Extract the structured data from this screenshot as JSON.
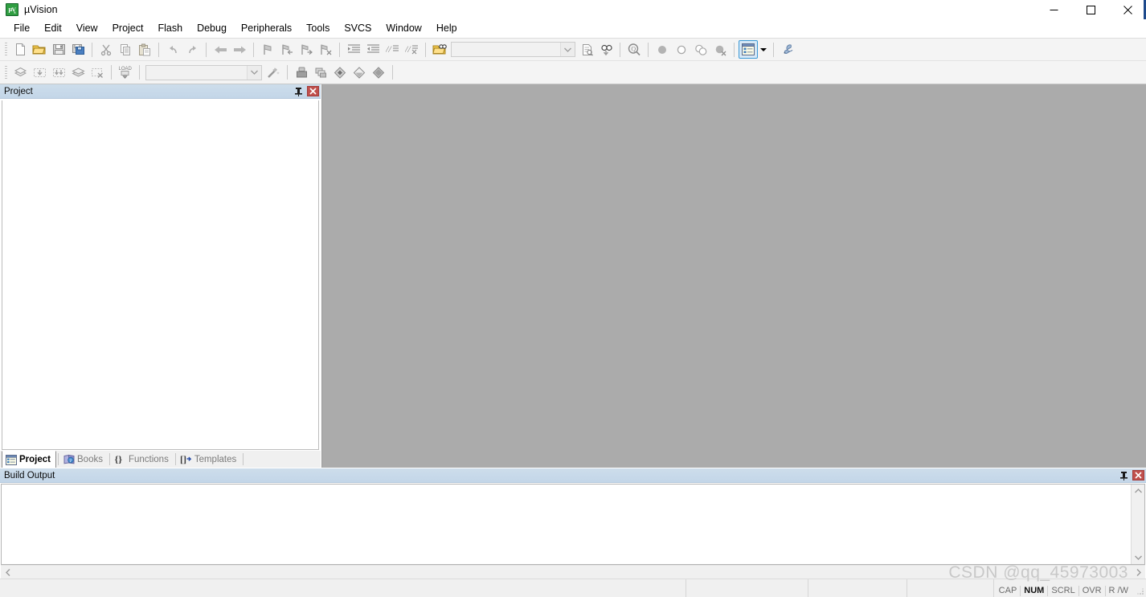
{
  "window": {
    "title": "µVision",
    "app_icon": "uvision-logo-icon",
    "controls": [
      {
        "name": "minimize-button",
        "glyph": "minimize-icon"
      },
      {
        "name": "maximize-button",
        "glyph": "maximize-icon"
      },
      {
        "name": "close-button",
        "glyph": "close-icon"
      }
    ]
  },
  "menubar": {
    "items": [
      {
        "label": "File"
      },
      {
        "label": "Edit"
      },
      {
        "label": "View"
      },
      {
        "label": "Project"
      },
      {
        "label": "Flash"
      },
      {
        "label": "Debug"
      },
      {
        "label": "Peripherals"
      },
      {
        "label": "Tools"
      },
      {
        "label": "SVCS"
      },
      {
        "label": "Window"
      },
      {
        "label": "Help"
      }
    ]
  },
  "toolbar_main": {
    "buttons": [
      {
        "name": "new-file-button",
        "icon": "new-file-icon"
      },
      {
        "name": "open-file-button",
        "icon": "open-folder-icon"
      },
      {
        "name": "save-button",
        "icon": "save-disk-icon"
      },
      {
        "name": "save-all-button",
        "icon": "save-all-icon"
      },
      {
        "name": "cut-button",
        "icon": "scissors-icon"
      },
      {
        "name": "copy-button",
        "icon": "copy-icon"
      },
      {
        "name": "paste-button",
        "icon": "paste-icon"
      },
      {
        "name": "undo-button",
        "icon": "undo-arrow-icon"
      },
      {
        "name": "redo-button",
        "icon": "redo-arrow-icon"
      },
      {
        "name": "navigate-back-button",
        "icon": "arrow-left-icon"
      },
      {
        "name": "navigate-forward-button",
        "icon": "arrow-right-icon"
      },
      {
        "name": "toggle-bookmark-button",
        "icon": "bookmark-icon"
      },
      {
        "name": "previous-bookmark-button",
        "icon": "bookmark-prev-icon"
      },
      {
        "name": "next-bookmark-button",
        "icon": "bookmark-next-icon"
      },
      {
        "name": "clear-bookmarks-button",
        "icon": "bookmark-clear-icon"
      },
      {
        "name": "indent-button",
        "icon": "indent-right-icon"
      },
      {
        "name": "outdent-button",
        "icon": "indent-left-icon"
      },
      {
        "name": "comment-button",
        "icon": "comment-lines-icon"
      },
      {
        "name": "uncomment-button",
        "icon": "uncomment-lines-icon"
      }
    ],
    "find_in_files_button": {
      "name": "find-in-files-button",
      "icon": "open-find-icon"
    },
    "find_combo": {
      "value": "",
      "placeholder": ""
    },
    "after_combo_buttons": [
      {
        "name": "browse-symbol-button",
        "icon": "document-search-icon"
      },
      {
        "name": "find-next-button",
        "icon": "binoculars-down-icon"
      },
      {
        "name": "incremental-find-button",
        "icon": "magnifier-icon"
      }
    ],
    "breakpoint_buttons": [
      {
        "name": "insert-breakpoint-button",
        "icon": "breakpoint-filled-icon"
      },
      {
        "name": "disable-breakpoint-button",
        "icon": "breakpoint-hollow-icon"
      },
      {
        "name": "disable-all-breakpoints-button",
        "icon": "breakpoints-two-icon"
      },
      {
        "name": "kill-all-breakpoints-button",
        "icon": "breakpoint-kill-icon"
      }
    ],
    "window_layout_button": {
      "name": "project-window-toggle-button",
      "icon": "project-window-icon",
      "active": true
    },
    "layout_dropdown": {
      "name": "window-layout-dropdown",
      "icon": "chevron-down-icon"
    },
    "configure_button": {
      "name": "configure-tools-button",
      "icon": "wrench-icon"
    }
  },
  "toolbar_build": {
    "buttons": [
      {
        "name": "translate-file-button",
        "icon": "translate-file-icon"
      },
      {
        "name": "build-target-button",
        "icon": "build-target-icon"
      },
      {
        "name": "rebuild-all-button",
        "icon": "rebuild-all-icon"
      },
      {
        "name": "batch-build-button",
        "icon": "batch-build-icon"
      },
      {
        "name": "stop-build-button",
        "icon": "stop-build-icon"
      },
      {
        "name": "download-to-flash-button",
        "icon": "load-flash-icon"
      }
    ],
    "target_combo": {
      "value": "",
      "placeholder": ""
    },
    "target_options_button": {
      "name": "target-options-button",
      "icon": "magic-wand-icon"
    },
    "after_buttons": [
      {
        "name": "manage-project-items-button",
        "icon": "manage-project-icon"
      },
      {
        "name": "manage-multi-project-button",
        "icon": "multi-project-icon"
      },
      {
        "name": "pack-installer-button",
        "icon": "pack-installer-icon"
      },
      {
        "name": "manage-run-time-env-button",
        "icon": "rte-diamond-icon"
      },
      {
        "name": "select-software-packs-button",
        "icon": "software-packs-icon"
      }
    ]
  },
  "project_dock": {
    "caption": "Project",
    "pin_icon": "pin-icon",
    "close_icon": "close-icon",
    "tree_items": [],
    "tabs": [
      {
        "label": "Project",
        "icon": "project-tree-icon",
        "selected": true
      },
      {
        "label": "Books",
        "icon": "books-icon",
        "selected": false
      },
      {
        "label": "Functions",
        "icon": "braces-icon",
        "selected": false
      },
      {
        "label": "Templates",
        "icon": "templates-icon",
        "selected": false
      }
    ]
  },
  "editor": {
    "content": "",
    "background_color": "#ababab"
  },
  "build_output": {
    "caption": "Build Output",
    "pin_icon": "pin-icon",
    "close_icon": "close-icon",
    "text": "",
    "scroll_up_icon": "chevron-up-icon",
    "scroll_down_icon": "chevron-down-icon",
    "hscroll_left_icon": "chevron-left-icon",
    "hscroll_right_icon": "chevron-right-icon"
  },
  "statusbar": {
    "message": "",
    "cells": [
      "",
      "",
      ""
    ],
    "indicators": [
      {
        "label": "CAP",
        "on": false
      },
      {
        "label": "NUM",
        "on": true
      },
      {
        "label": "SCRL",
        "on": false
      },
      {
        "label": "OVR",
        "on": false
      },
      {
        "label": "R /W",
        "on": false
      }
    ]
  },
  "watermark": {
    "text": "CSDN @qq_45973003"
  },
  "colors": {
    "accent_blue": "#3c9ad6",
    "caption_bg": "#c7d9ea",
    "editor_gray": "#ababab",
    "close_red": "#c0504d",
    "toolbar_bg": "#f4f4f4"
  }
}
